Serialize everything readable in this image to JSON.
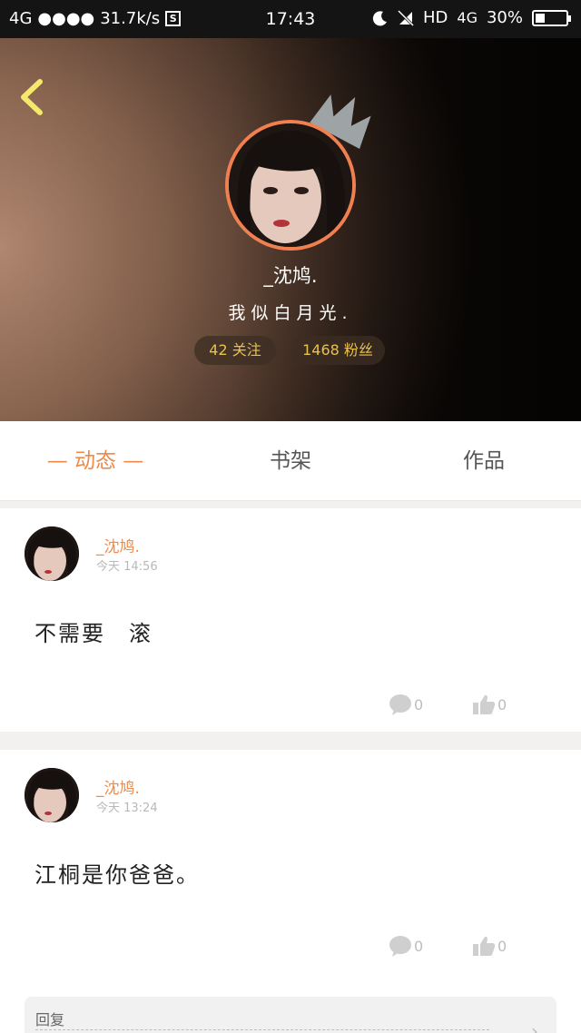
{
  "status_bar": {
    "network": "4G",
    "signal": "●●●●",
    "speed": "31.7k/s",
    "app_badge": "S",
    "time": "17:43",
    "hd_label": "HD",
    "network_right": "4G",
    "battery_percent": "30%",
    "battery_level": 0.3,
    "icons": [
      "moon-icon",
      "no-signal-icon",
      "battery-icon"
    ]
  },
  "profile": {
    "nickname": "_沈鸠.",
    "signature": "我似白月光.",
    "follow_chip": "42 关注",
    "fans_chip": "1468 粉丝",
    "accent_color": "#ee8a4c"
  },
  "tabs": [
    {
      "label": "— 动态 —",
      "active": true
    },
    {
      "label": "书架",
      "active": false
    },
    {
      "label": "作品",
      "active": false
    }
  ],
  "posts": [
    {
      "author": "_沈鸠.",
      "time": "今天 14:56",
      "content": "不需要　滚",
      "comments": "0",
      "likes": "0"
    },
    {
      "author": "_沈鸠.",
      "time": "今天 13:24",
      "content": "江桐是你爸爸。",
      "comments": "0",
      "likes": "0",
      "reply_label": "回复"
    }
  ]
}
